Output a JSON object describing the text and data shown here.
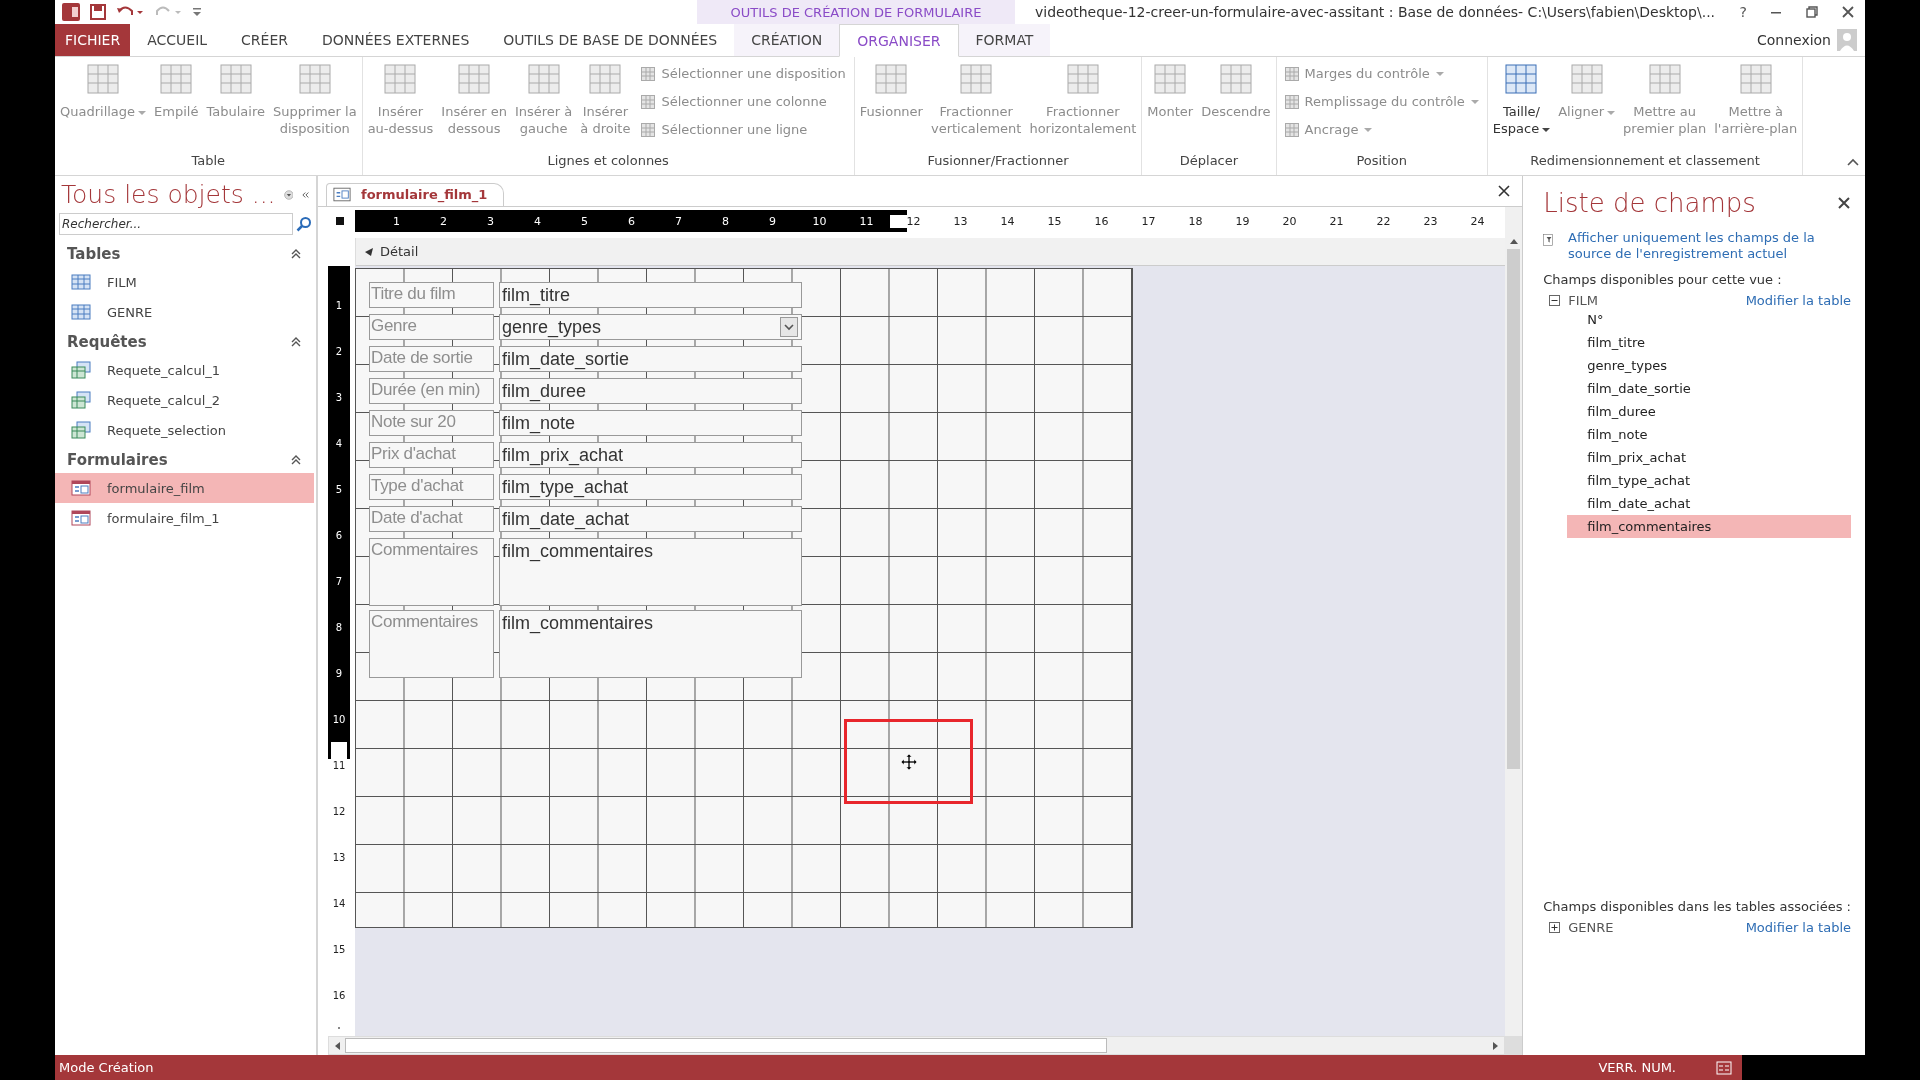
{
  "context_header": "OUTILS DE CRÉATION DE FORMULAIRE",
  "window": {
    "title": "videotheque-12-creer-un-formulaire-avec-assitant : Base de données- C:\\Users\\fabien\\Desktop\\...",
    "help": "?"
  },
  "tabs": [
    {
      "label": "FICHIER",
      "kind": "file",
      "selected": false
    },
    {
      "label": "ACCUEIL",
      "kind": "tab",
      "selected": false
    },
    {
      "label": "CRÉER",
      "kind": "tab",
      "selected": false
    },
    {
      "label": "DONNÉES EXTERNES",
      "kind": "tab",
      "selected": false
    },
    {
      "label": "OUTILS DE BASE DE DONNÉES",
      "kind": "tab",
      "selected": false
    },
    {
      "label": "CRÉATION",
      "kind": "context",
      "selected": false
    },
    {
      "label": "ORGANISER",
      "kind": "context",
      "selected": true
    },
    {
      "label": "FORMAT",
      "kind": "context",
      "selected": false
    }
  ],
  "account": "Connexion",
  "ribbon": {
    "groups": [
      {
        "label": "Table",
        "items": [
          {
            "kind": "large",
            "label": "Quadrillage",
            "disabled": true,
            "dropdown": true
          },
          {
            "kind": "large",
            "label": "Empilé",
            "disabled": true,
            "dropdown": false
          },
          {
            "kind": "large",
            "label": "Tabulaire",
            "disabled": true,
            "dropdown": false
          },
          {
            "kind": "large",
            "label": "Supprimer la\ndisposition",
            "disabled": true,
            "dropdown": false
          }
        ]
      },
      {
        "label": "Lignes et colonnes",
        "items": [
          {
            "kind": "large",
            "label": "Insérer\nau-dessus",
            "disabled": true,
            "dropdown": false
          },
          {
            "kind": "large",
            "label": "Insérer en\ndessous",
            "disabled": true,
            "dropdown": false
          },
          {
            "kind": "large",
            "label": "Insérer à\ngauche",
            "disabled": true,
            "dropdown": false
          },
          {
            "kind": "large",
            "label": "Insérer\nà droite",
            "disabled": true,
            "dropdown": false
          },
          {
            "kind": "small",
            "label": "Sélectionner une disposition",
            "disabled": true,
            "dropdown": false
          },
          {
            "kind": "small",
            "label": "Sélectionner une colonne",
            "disabled": true,
            "dropdown": false
          },
          {
            "kind": "small",
            "label": "Sélectionner une ligne",
            "disabled": true,
            "dropdown": false
          }
        ]
      },
      {
        "label": "Fusionner/Fractionner",
        "items": [
          {
            "kind": "large",
            "label": "Fusionner",
            "disabled": true,
            "dropdown": false
          },
          {
            "kind": "large",
            "label": "Fractionner\nverticalement",
            "disabled": true,
            "dropdown": false
          },
          {
            "kind": "large",
            "label": "Fractionner\nhorizontalement",
            "disabled": true,
            "dropdown": false
          }
        ]
      },
      {
        "label": "Déplacer",
        "items": [
          {
            "kind": "large",
            "label": "Monter",
            "disabled": true,
            "dropdown": false
          },
          {
            "kind": "large",
            "label": "Descendre",
            "disabled": true,
            "dropdown": false
          }
        ]
      },
      {
        "label": "Position",
        "items": [
          {
            "kind": "small",
            "label": "Marges du contrôle",
            "disabled": true,
            "dropdown": true
          },
          {
            "kind": "small",
            "label": "Remplissage du contrôle",
            "disabled": true,
            "dropdown": true
          },
          {
            "kind": "small",
            "label": "Ancrage",
            "disabled": true,
            "dropdown": true
          }
        ]
      },
      {
        "label": "Redimensionnement et classement",
        "items": [
          {
            "kind": "large",
            "label": "Taille/\nEspace",
            "disabled": false,
            "dropdown": true
          },
          {
            "kind": "large",
            "label": "Aligner",
            "disabled": true,
            "dropdown": true
          },
          {
            "kind": "large",
            "label": "Mettre au\npremier plan",
            "disabled": true,
            "dropdown": false
          },
          {
            "kind": "large",
            "label": "Mettre à\nl'arrière-plan",
            "disabled": true,
            "dropdown": false
          }
        ]
      }
    ]
  },
  "nav_pane": {
    "title": "Tous les objets ...",
    "search": {
      "placeholder": "Rechercher..."
    },
    "groups": [
      {
        "label": "Tables",
        "expanded": true,
        "items": [
          {
            "label": "FILM",
            "kind": "table",
            "selected": false
          },
          {
            "label": "GENRE",
            "kind": "table",
            "selected": false
          }
        ]
      },
      {
        "label": "Requêtes",
        "expanded": true,
        "items": [
          {
            "label": "Requete_calcul_1",
            "kind": "query",
            "selected": false
          },
          {
            "label": "Requete_calcul_2",
            "kind": "query",
            "selected": false
          },
          {
            "label": "Requete_selection",
            "kind": "query",
            "selected": false
          }
        ]
      },
      {
        "label": "Formulaires",
        "expanded": true,
        "items": [
          {
            "label": "formulaire_film",
            "kind": "form",
            "selected": true
          },
          {
            "label": "formulaire_film_1",
            "kind": "form",
            "selected": false
          }
        ]
      }
    ]
  },
  "document": {
    "tab": {
      "label": "formulaire_film_1",
      "selected": true
    },
    "ruler": {
      "labels": [
        "1",
        "2",
        "3",
        "4",
        "5",
        "6",
        "7",
        "8",
        "9",
        "10",
        "11",
        "12",
        "13",
        "14",
        "15",
        "16",
        "17",
        "18",
        "19",
        "20",
        "21",
        "22",
        "23",
        "24"
      ],
      "level": 0.48
    },
    "vertical_ruler": {
      "labels": [
        "1",
        "2",
        "3",
        "4",
        "5",
        "6",
        "7",
        "8",
        "9",
        "10",
        "11",
        "12",
        "13",
        "14",
        "15",
        "16"
      ],
      "level": 0.64
    },
    "section": "Détail",
    "controls": [
      {
        "label": "Titre du film",
        "field": "film_titre",
        "kind": "text"
      },
      {
        "label": "Genre",
        "field": "genre_types",
        "kind": "combo"
      },
      {
        "label": "Date de sortie",
        "field": "film_date_sortie",
        "kind": "text"
      },
      {
        "label": "Durée (en min)",
        "field": "film_duree",
        "kind": "text"
      },
      {
        "label": "Note sur 20",
        "field": "film_note",
        "kind": "text"
      },
      {
        "label": "Prix d'achat",
        "field": "film_prix_achat",
        "kind": "text"
      },
      {
        "label": "Type d'achat",
        "field": "film_type_achat",
        "kind": "text"
      },
      {
        "label": "Date d'achat",
        "field": "film_date_achat",
        "kind": "text"
      },
      {
        "label": "Commentaires",
        "field": "film_commentaires",
        "kind": "memo"
      },
      {
        "label": "Commentaires",
        "field": "film_commentaires",
        "kind": "memo"
      }
    ]
  },
  "field_list": {
    "title": "Liste de champs",
    "filter_link": "Afficher uniquement les champs de la source de l'enregistrement actuel",
    "available_heading": "Champs disponibles pour cette vue :",
    "tables": [
      {
        "name": "FILM",
        "expanded": true,
        "edit_link": "Modifier la table",
        "fields": [
          {
            "name": "N°",
            "selected": false
          },
          {
            "name": "film_titre",
            "selected": false
          },
          {
            "name": "genre_types",
            "selected": false
          },
          {
            "name": "film_date_sortie",
            "selected": false
          },
          {
            "name": "film_duree",
            "selected": false
          },
          {
            "name": "film_note",
            "selected": false
          },
          {
            "name": "film_prix_achat",
            "selected": false
          },
          {
            "name": "film_type_achat",
            "selected": false
          },
          {
            "name": "film_date_achat",
            "selected": false
          },
          {
            "name": "film_commentaires",
            "selected": true
          }
        ]
      }
    ],
    "related_heading": "Champs disponibles dans les tables associées :",
    "related_tables": [
      {
        "name": "GENRE",
        "expanded": false,
        "edit_link": "Modifier la table"
      }
    ]
  },
  "status_bar": {
    "mode": "Mode Création",
    "indicators": [
      "VERR. NUM."
    ]
  }
}
